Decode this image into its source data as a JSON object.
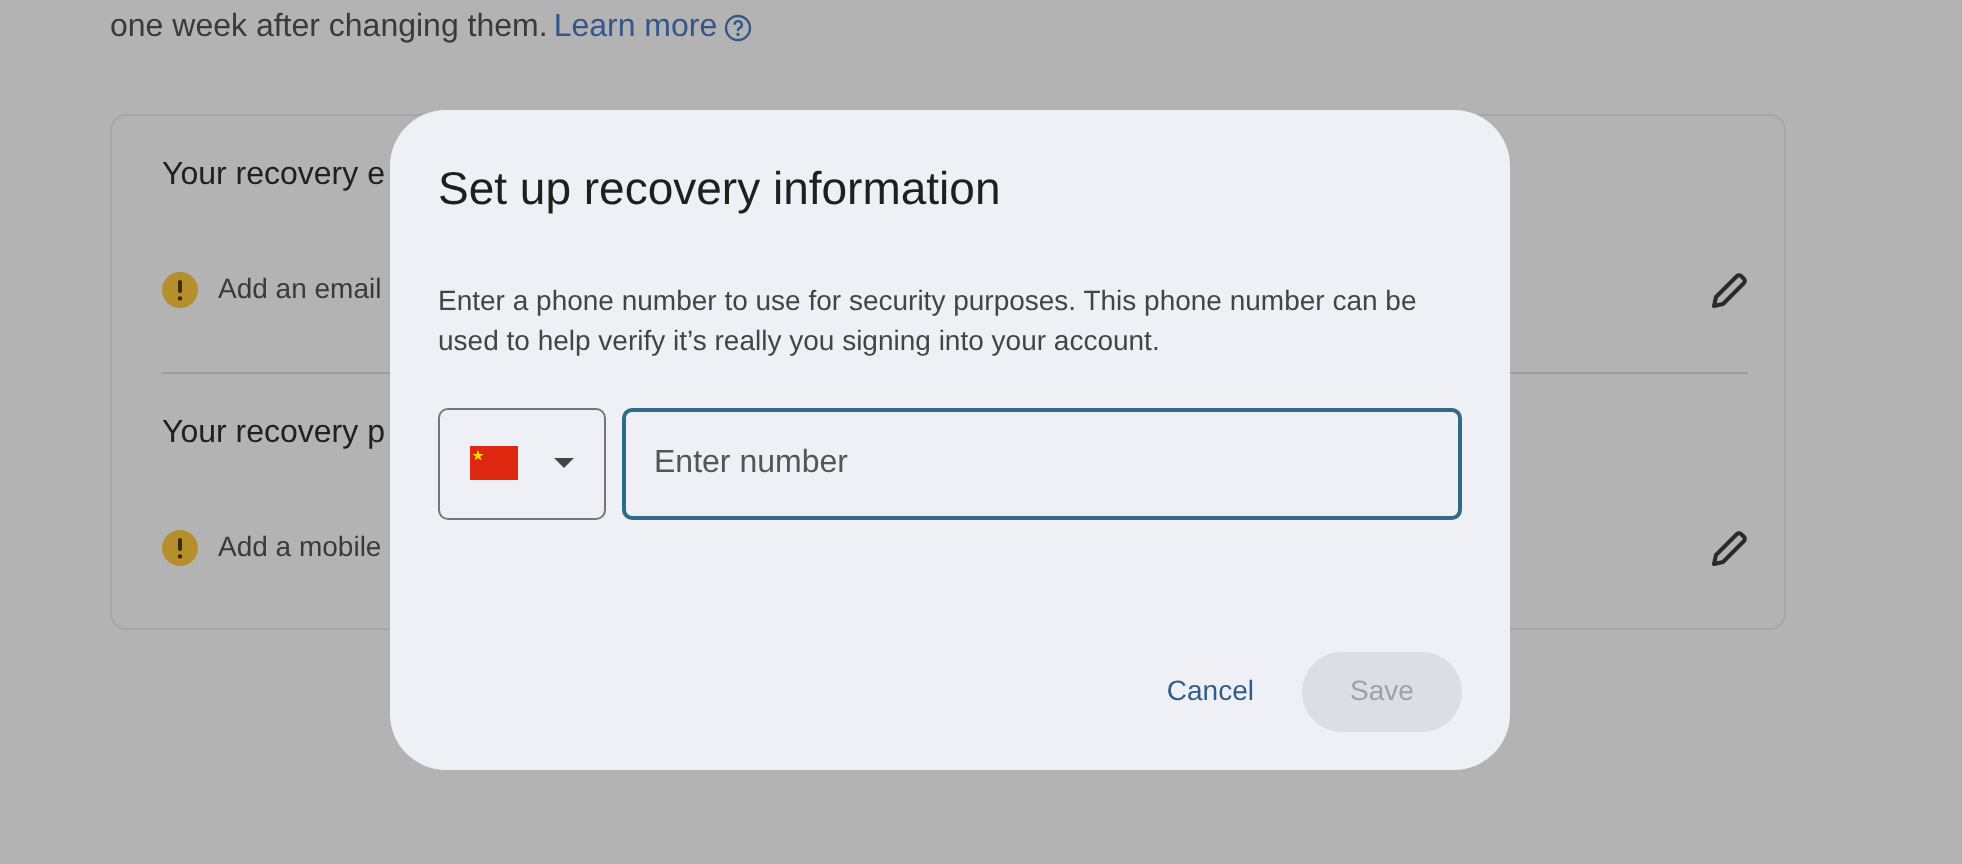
{
  "intro": {
    "text": "one week after changing them.",
    "link": "Learn more"
  },
  "recovery_items": [
    {
      "title": "Your recovery e",
      "action": "Add an email"
    },
    {
      "title": "Your recovery p",
      "action": "Add a mobile"
    }
  ],
  "dialog": {
    "title": "Set up recovery information",
    "description": "Enter a phone number to use for security purposes. This phone number can be used to help verify it’s really you signing into your account.",
    "phone_field": {
      "placeholder": "Enter number",
      "focused": true
    },
    "buttons": [
      {
        "label": "Cancel",
        "kind": "text",
        "disabled": false
      },
      {
        "label": "Save",
        "kind": "filled",
        "disabled": true
      }
    ]
  }
}
